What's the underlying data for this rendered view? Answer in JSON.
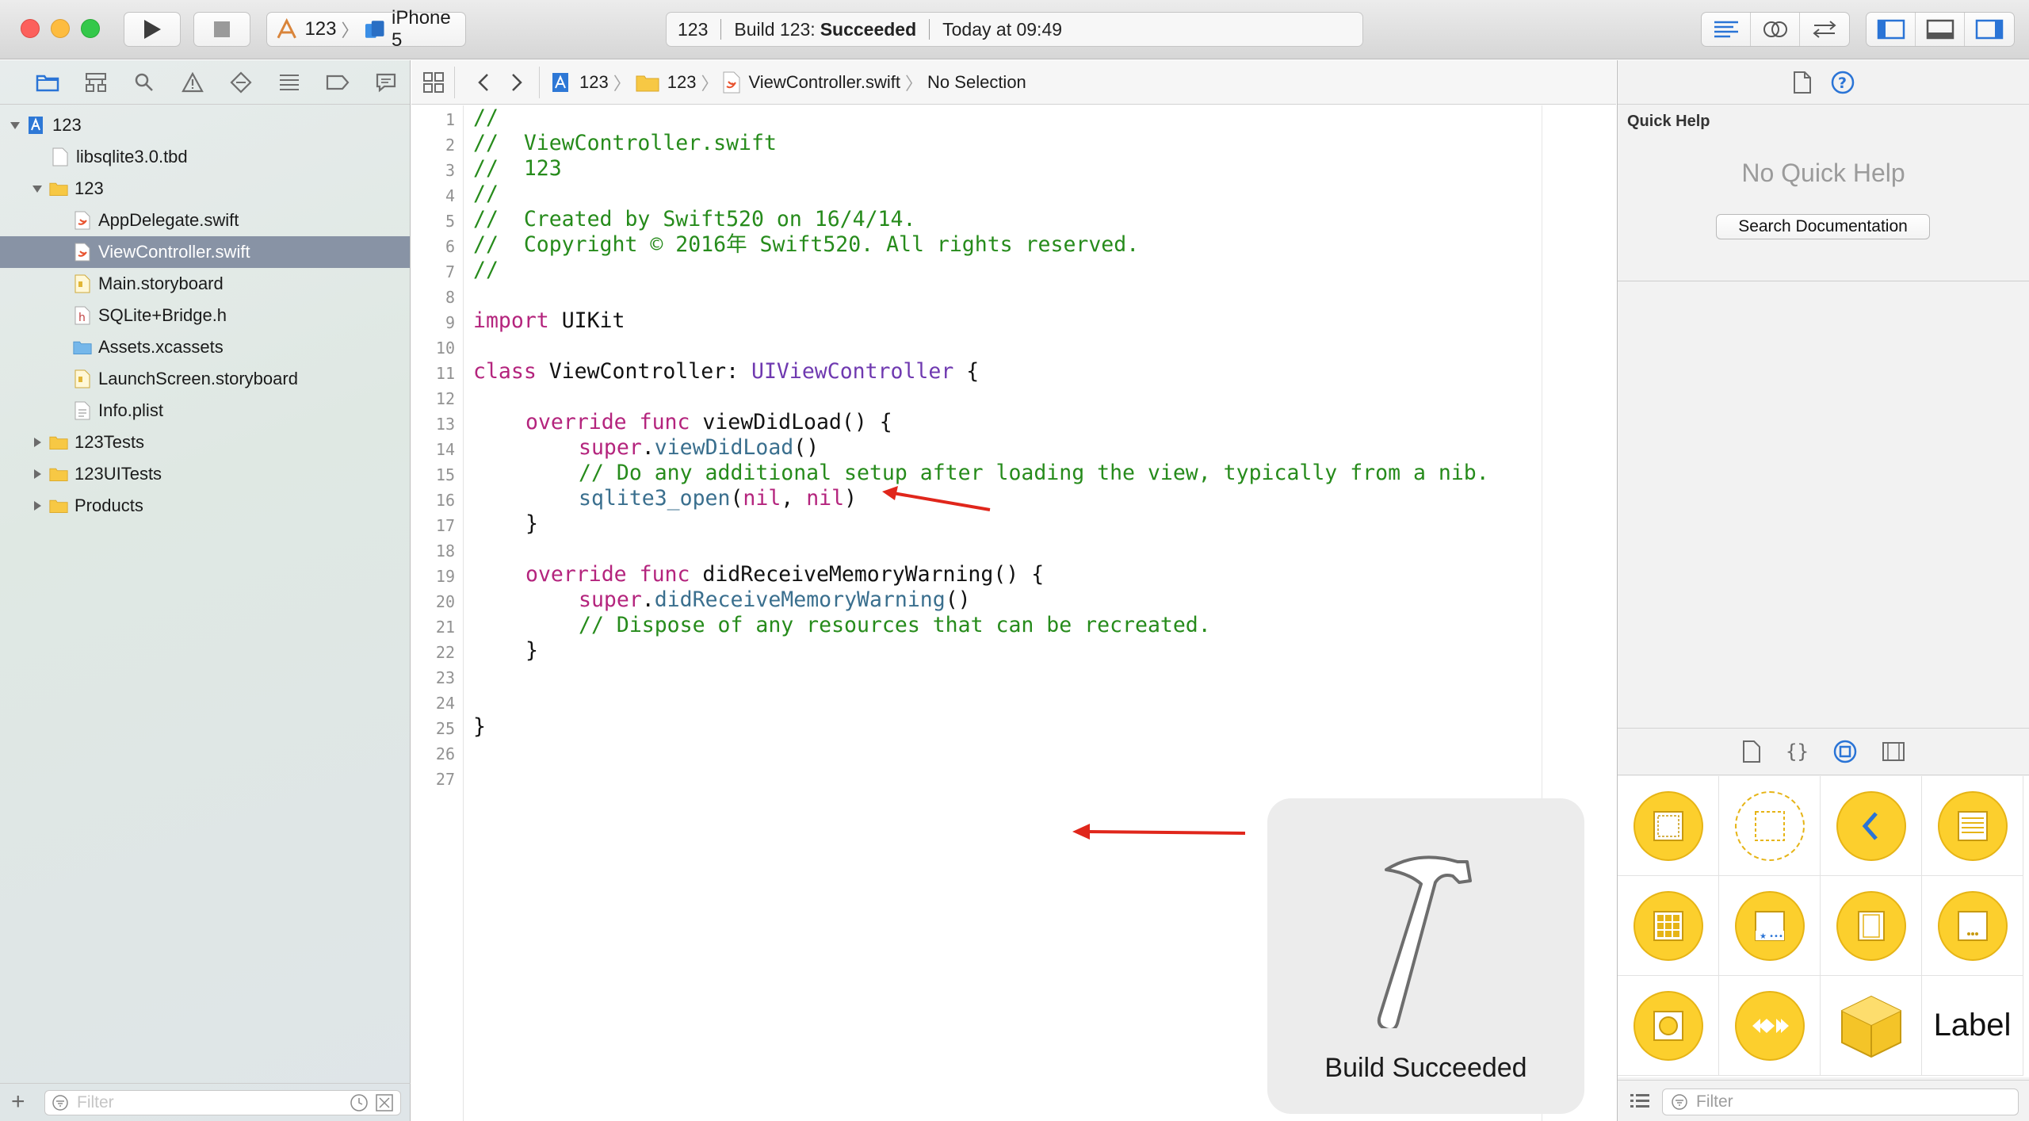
{
  "toolbar": {
    "scheme_target": "123",
    "scheme_device": "iPhone 5",
    "status_project": "123",
    "status_build_prefix": "Build 123:",
    "status_build_result": "Succeeded",
    "status_time": "Today at 09:49"
  },
  "navigator": {
    "items": [
      {
        "label": "123"
      },
      {
        "label": "libsqlite3.0.tbd"
      },
      {
        "label": "123"
      },
      {
        "label": "AppDelegate.swift"
      },
      {
        "label": "ViewController.swift"
      },
      {
        "label": "Main.storyboard"
      },
      {
        "label": "SQLite+Bridge.h"
      },
      {
        "label": "Assets.xcassets"
      },
      {
        "label": "LaunchScreen.storyboard"
      },
      {
        "label": "Info.plist"
      },
      {
        "label": "123Tests"
      },
      {
        "label": "123UITests"
      },
      {
        "label": "Products"
      }
    ],
    "filter_placeholder": "Filter"
  },
  "jumpbar": {
    "project": "123",
    "group": "123",
    "file": "ViewController.swift",
    "selection": "No Selection"
  },
  "editor": {
    "line_numbers": [
      "1",
      "2",
      "3",
      "4",
      "5",
      "6",
      "7",
      "8",
      "9",
      "10",
      "11",
      "12",
      "13",
      "14",
      "15",
      "16",
      "17",
      "18",
      "19",
      "20",
      "21",
      "22",
      "23",
      "24",
      "25",
      "26",
      "27"
    ],
    "lines": {
      "l1": "//",
      "l2": "//  ViewController.swift",
      "l3": "//  123",
      "l4": "//",
      "l5": "//  Created by Swift520 on 16/4/14.",
      "l6": "//  Copyright © 2016年 Swift520. All rights reserved.",
      "l7": "//",
      "l9_kw": "import",
      "l9_rest": " UIKit",
      "l11_kw": "class",
      "l11_name": " ViewController: ",
      "l11_type": "UIViewController",
      "l11_end": " {",
      "l13_kw1": "override",
      "l13_kw2": "func",
      "l13_rest": " viewDidLoad() {",
      "l14_kw": "super",
      "l14_dot": ".",
      "l14_fn": "viewDidLoad",
      "l14_end": "()",
      "l15": "// Do any additional setup after loading the view, typically from a nib.",
      "l16_fn": "sqlite3_open",
      "l16_p1": "(",
      "l16_nil1": "nil",
      "l16_comma": ", ",
      "l16_nil2": "nil",
      "l16_p2": ")",
      "l17": "}",
      "l19_kw1": "override",
      "l19_kw2": "func",
      "l19_rest": " didReceiveMemoryWarning() {",
      "l20_kw": "super",
      "l20_dot": ".",
      "l20_fn": "didReceiveMemoryWarning",
      "l20_end": "()",
      "l21": "// Dispose of any resources that can be recreated.",
      "l22": "}",
      "l25": "}"
    },
    "hud_label": "Build Succeeded"
  },
  "inspector": {
    "quick_help_title": "Quick Help",
    "no_quick_help": "No Quick Help",
    "search_button": "Search Documentation",
    "library_label_item": "Label",
    "filter_placeholder": "Filter"
  },
  "colors": {
    "comment": "#268b1b",
    "keyword": "#b4247d",
    "type": "#6f39b0",
    "function": "#3a6f8e",
    "selection_row": "#8893a5",
    "library_icon": "#fccf2d",
    "arrow": "#e0261b"
  }
}
